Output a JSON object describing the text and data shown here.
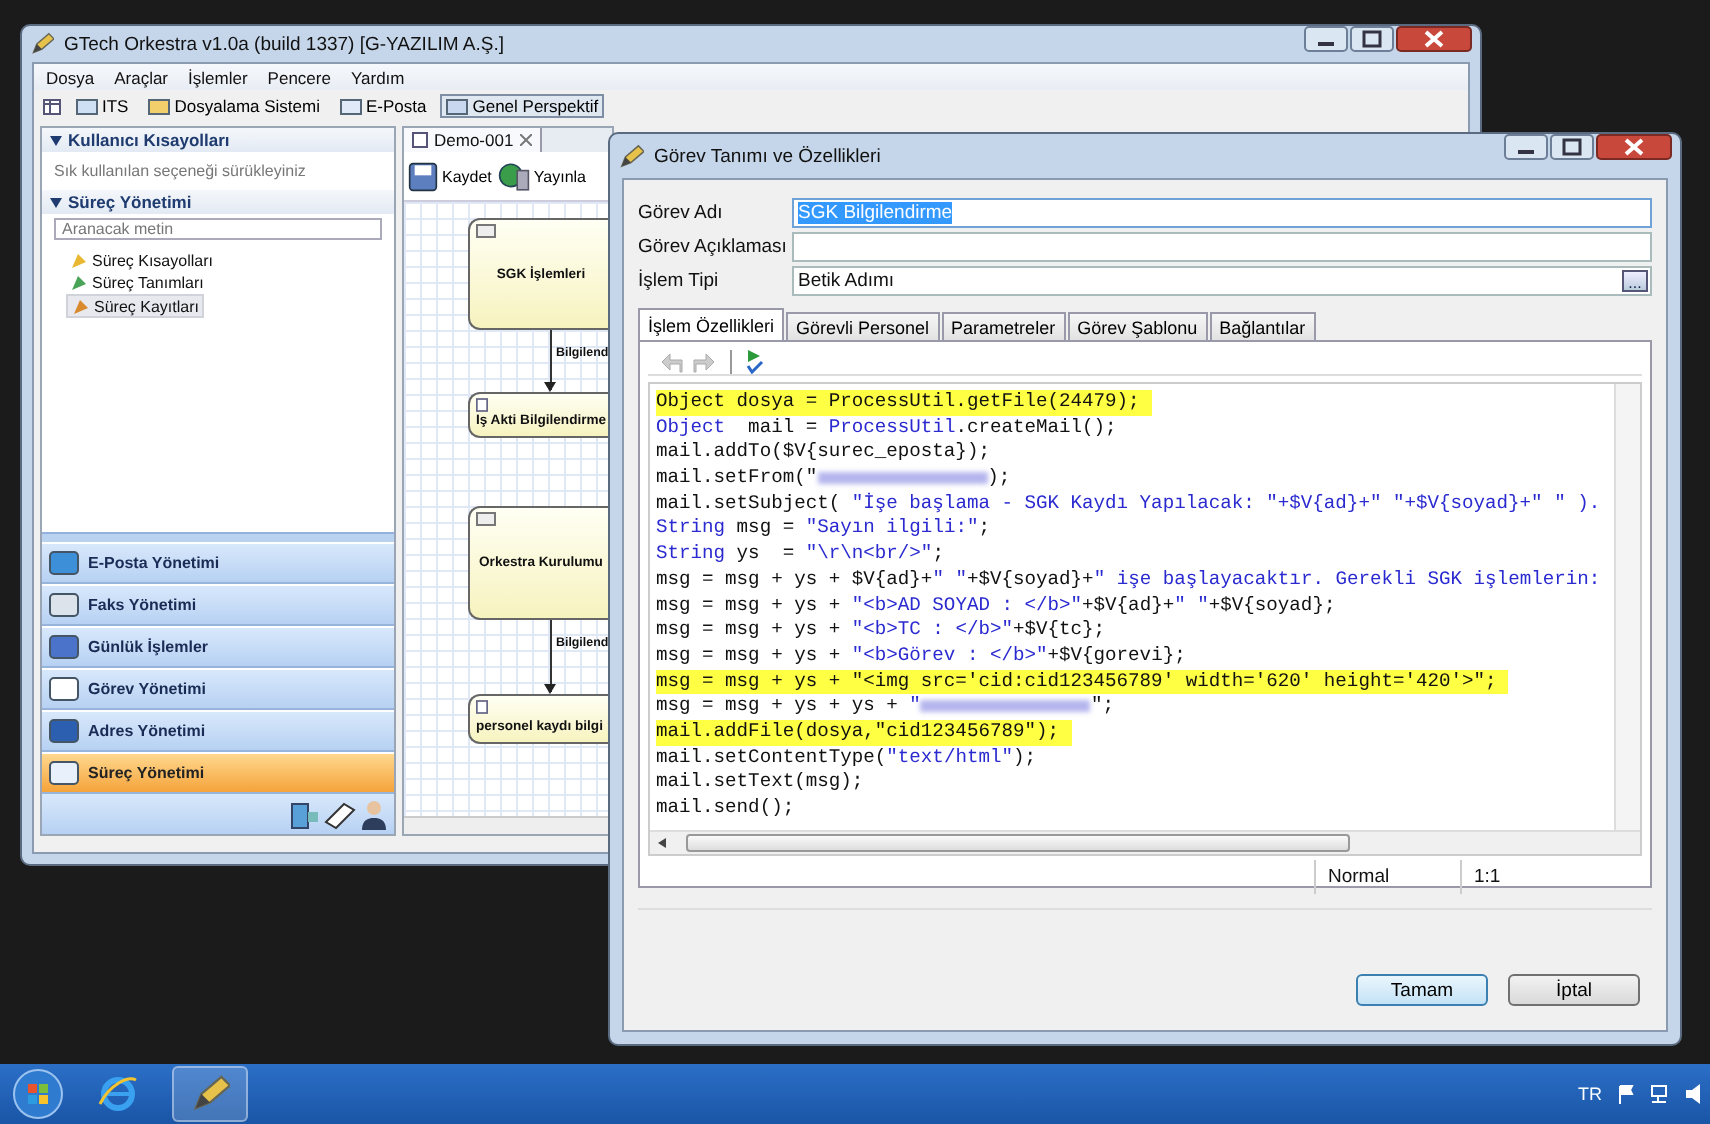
{
  "main_window": {
    "title": "GTech Orkestra v1.0a (build 1337) [G-YAZILIM A.Ş.]",
    "menu": [
      "Dosya",
      "Araçlar",
      "İşlemler",
      "Pencere",
      "Yardım"
    ],
    "toolbar": [
      {
        "label": "ITS",
        "selected": false
      },
      {
        "label": "Dosyalama Sistemi",
        "selected": false
      },
      {
        "label": "E-Posta",
        "selected": false
      },
      {
        "label": "Genel Perspektif",
        "selected": true
      }
    ],
    "shortcuts_panel": {
      "title": "Kullanıcı Kısayolları",
      "hint": "Sık kullanılan seçeneği sürükleyiniz"
    },
    "process_panel": {
      "title": "Süreç Yönetimi",
      "search_placeholder": "Aranacak metin",
      "items": [
        {
          "label": "Süreç Kısayolları",
          "selected": false
        },
        {
          "label": "Süreç Tanımları",
          "selected": false
        },
        {
          "label": "Süreç Kayıtları",
          "selected": true
        }
      ]
    },
    "nav_buttons": [
      {
        "label": "E-Posta Yönetimi",
        "selected": false
      },
      {
        "label": "Faks Yönetimi",
        "selected": false
      },
      {
        "label": "Günlük İşlemler",
        "selected": false
      },
      {
        "label": "Görev Yönetimi",
        "selected": false
      },
      {
        "label": "Adres Yönetimi",
        "selected": false
      },
      {
        "label": "Süreç Yönetimi",
        "selected": true
      }
    ],
    "editor_tab": "Demo-001",
    "editor_toolbar": [
      "Kaydet",
      "Yayınla"
    ],
    "diagram": {
      "nodes": [
        {
          "label": "SGK İşlemleri",
          "kind": "process"
        },
        {
          "label": "Iş Akti Bilgilendirme",
          "kind": "script"
        },
        {
          "label": "Orkestra Kurulumu",
          "kind": "process"
        },
        {
          "label": "personel kaydı bilgi",
          "kind": "script"
        }
      ],
      "edges": [
        {
          "label": "Bilgilend"
        },
        {
          "label": "Bilgilend"
        }
      ]
    }
  },
  "dialog": {
    "title": "Görev Tanımı ve Özellikleri",
    "fields": [
      {
        "label": "Görev Adı",
        "value": "SGK Bilgilendirme",
        "kind": "selected"
      },
      {
        "label": "Görev Açıklaması",
        "kind": "text"
      },
      {
        "label": "İşlem Tipi",
        "value": "Betik Adımı",
        "kind": "picker",
        "button_label": "..."
      }
    ],
    "tabs": [
      {
        "label": "İşlem Özellikleri",
        "selected": true
      },
      {
        "label": "Görevli Personel",
        "selected": false
      },
      {
        "label": "Parametreler",
        "selected": false
      },
      {
        "label": "Görev Şablonu",
        "selected": false
      },
      {
        "label": "Bağlantılar",
        "selected": false
      }
    ],
    "code_lines": [
      {
        "highlighted": true,
        "parts": [
          {
            "text": "Object dosya = ProcessUtil.getFile(24479);",
            "kind": "plain"
          }
        ]
      },
      {
        "highlighted": false,
        "parts": [
          {
            "text": "Object",
            "kind": "blue"
          },
          {
            "text": "  mail = ",
            "kind": "plain"
          },
          {
            "text": "ProcessUtil",
            "kind": "blue"
          },
          {
            "text": ".createMail();",
            "kind": "plain"
          }
        ]
      },
      {
        "highlighted": false,
        "parts": [
          {
            "text": "mail.addTo($V{surec_eposta});",
            "kind": "plain"
          }
        ]
      },
      {
        "highlighted": false,
        "parts": [
          {
            "text": "mail.setFrom(\"",
            "kind": "plain"
          },
          {
            "kind": "redacted"
          },
          {
            "text": ");",
            "kind": "plain"
          }
        ]
      },
      {
        "highlighted": false,
        "parts": [
          {
            "text": "mail.setSubject( ",
            "kind": "plain"
          },
          {
            "text": "\"İşe başlama - SGK Kaydı Yapılacak: \"+$V{ad}+\" \"+$V{soyad}+\" \" ).",
            "kind": "blue"
          }
        ]
      },
      {
        "highlighted": false,
        "parts": [
          {
            "text": "String",
            "kind": "blue"
          },
          {
            "text": " msg = ",
            "kind": "plain"
          },
          {
            "text": "\"Sayın ilgili:\"",
            "kind": "blue"
          },
          {
            "text": ";",
            "kind": "plain"
          }
        ]
      },
      {
        "highlighted": false,
        "parts": [
          {
            "text": "String",
            "kind": "blue"
          },
          {
            "text": " ys  = ",
            "kind": "plain"
          },
          {
            "text": "\"\\r\\n<br/>\"",
            "kind": "blue"
          },
          {
            "text": ";",
            "kind": "plain"
          }
        ]
      },
      {
        "highlighted": false,
        "parts": [
          {
            "text": "msg = msg + ys + $V{ad}+",
            "kind": "plain"
          },
          {
            "text": "\" \"",
            "kind": "blue"
          },
          {
            "text": "+$V{soyad}+",
            "kind": "plain"
          },
          {
            "text": "\" işe başlayacaktır. Gerekli SGK işlemlerin:",
            "kind": "blue"
          }
        ]
      },
      {
        "highlighted": false,
        "parts": [
          {
            "text": "msg = msg + ys + ",
            "kind": "plain"
          },
          {
            "text": "\"<b>AD SOYAD : </b>\"",
            "kind": "blue"
          },
          {
            "text": "+$V{ad}+",
            "kind": "plain"
          },
          {
            "text": "\" \"",
            "kind": "blue"
          },
          {
            "text": "+$V{soyad};",
            "kind": "plain"
          }
        ]
      },
      {
        "highlighted": false,
        "parts": [
          {
            "text": "msg = msg + ys + ",
            "kind": "plain"
          },
          {
            "text": "\"<b>TC : </b>\"",
            "kind": "blue"
          },
          {
            "text": "+$V{tc};",
            "kind": "plain"
          }
        ]
      },
      {
        "highlighted": false,
        "parts": [
          {
            "text": "msg = msg + ys + ",
            "kind": "plain"
          },
          {
            "text": "\"<b>Görev : </b>\"",
            "kind": "blue"
          },
          {
            "text": "+$V{gorevi};",
            "kind": "plain"
          }
        ]
      },
      {
        "highlighted": true,
        "parts": [
          {
            "text": "msg = msg + ys + \"<img src='cid:cid123456789' width='620' height='420'>\";",
            "kind": "plain"
          }
        ]
      },
      {
        "highlighted": false,
        "parts": [
          {
            "text": "msg = msg + ys + ys + ",
            "kind": "plain"
          },
          {
            "text": "\"",
            "kind": "blue"
          },
          {
            "kind": "redacted"
          },
          {
            "text": "\";",
            "kind": "plain"
          }
        ]
      },
      {
        "highlighted": true,
        "parts": [
          {
            "text": "mail.addFile(dosya,\"cid123456789\");",
            "kind": "plain"
          }
        ]
      },
      {
        "highlighted": false,
        "parts": [
          {
            "text": "mail.setContentType(",
            "kind": "plain"
          },
          {
            "text": "\"text/html\"",
            "kind": "blue"
          },
          {
            "text": ");",
            "kind": "plain"
          }
        ]
      },
      {
        "highlighted": false,
        "parts": [
          {
            "text": "mail.setText(msg);",
            "kind": "plain"
          }
        ]
      },
      {
        "highlighted": false,
        "parts": [
          {
            "text": "mail.send();",
            "kind": "plain"
          }
        ]
      }
    ],
    "status": [
      "Normal",
      "1:1"
    ],
    "buttons": [
      {
        "label": "Tamam",
        "default": true
      },
      {
        "label": "İptal",
        "default": false
      }
    ]
  },
  "taskbar": {
    "language": "TR"
  }
}
